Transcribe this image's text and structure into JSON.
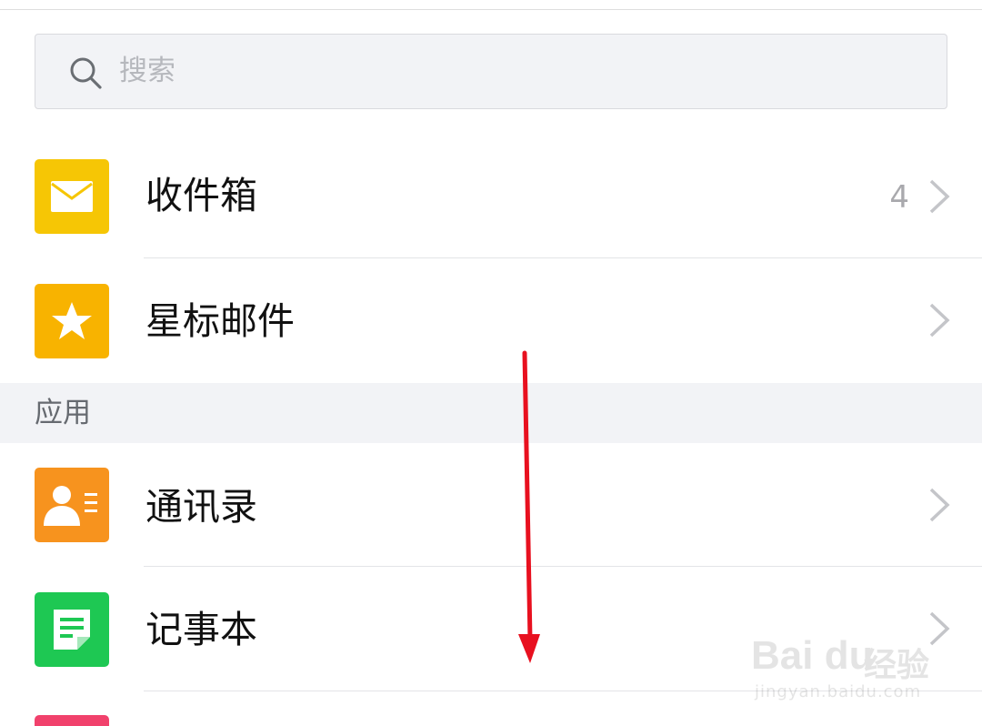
{
  "search": {
    "placeholder": "搜索",
    "icon": "search-icon"
  },
  "rows": [
    {
      "label": "收件箱",
      "count": "4",
      "icon": "envelope-icon",
      "icon_color": "#f6c605"
    },
    {
      "label": "星标邮件",
      "count": "",
      "icon": "star-icon",
      "icon_color": "#f8b300"
    }
  ],
  "section": {
    "label": "应用"
  },
  "apps": [
    {
      "label": "通讯录",
      "icon": "contact-card-icon",
      "icon_color": "#f7931e"
    },
    {
      "label": "记事本",
      "icon": "notepad-icon",
      "icon_color": "#1ec853"
    }
  ],
  "partial_next_icon_color": "#f1416c",
  "annotation": {
    "arrow_color": "#e8101f",
    "icon": "down-arrow-annotation"
  },
  "watermark": {
    "logo": "Bai du",
    "text": "经验",
    "url": "jingyan.baidu.com"
  }
}
